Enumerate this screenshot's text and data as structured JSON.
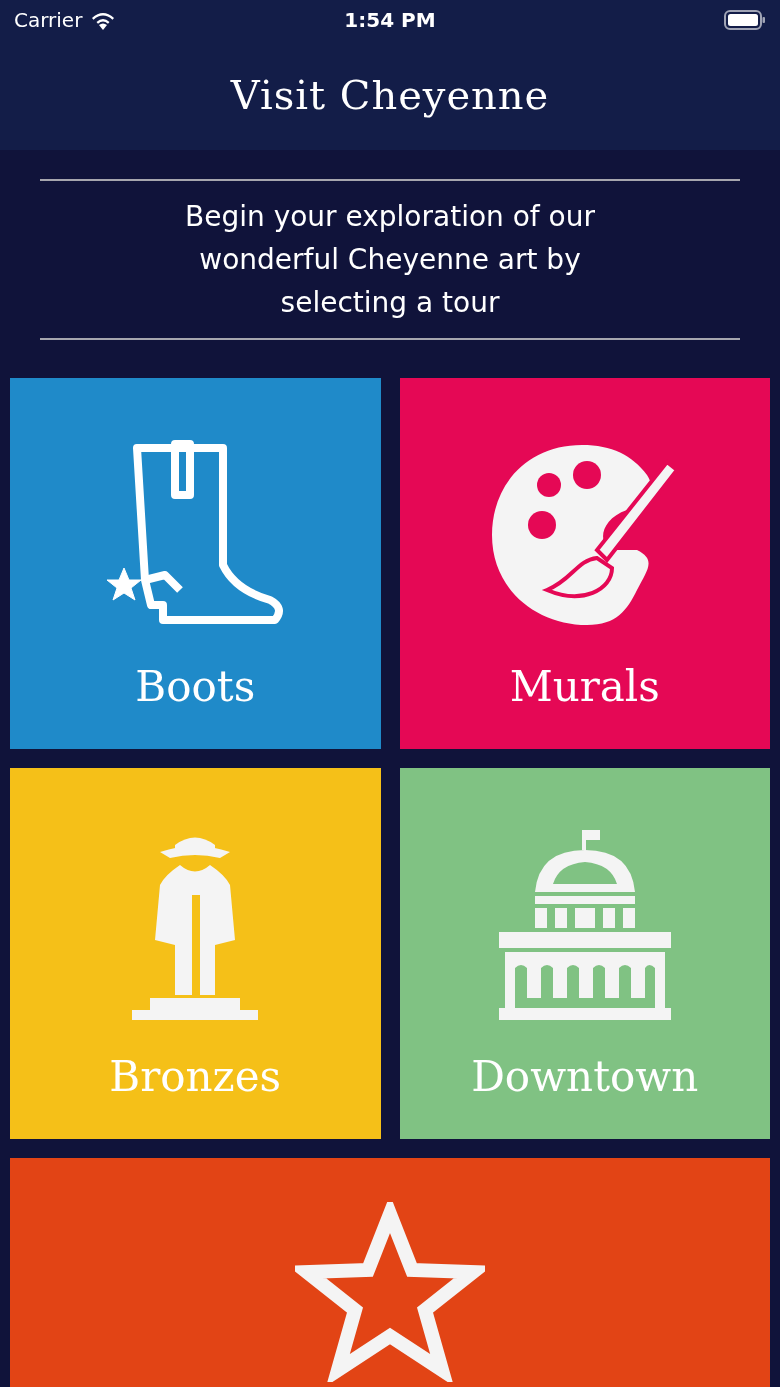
{
  "status_bar": {
    "carrier": "Carrier",
    "time": "1:54 PM"
  },
  "header": {
    "title": "Visit Cheyenne"
  },
  "intro": "Begin your exploration of our wonderful Cheyenne art by selecting a tour",
  "tours": [
    {
      "kind": "boot",
      "label": "Boots",
      "color": "#1f8ac9"
    },
    {
      "kind": "palette",
      "label": "Murals",
      "color": "#e50855"
    },
    {
      "kind": "statue",
      "label": "Bronzes",
      "color": "#f5c018"
    },
    {
      "kind": "capitol",
      "label": "Downtown",
      "color": "#80c283"
    },
    {
      "kind": "star",
      "color": "#e24415"
    }
  ]
}
